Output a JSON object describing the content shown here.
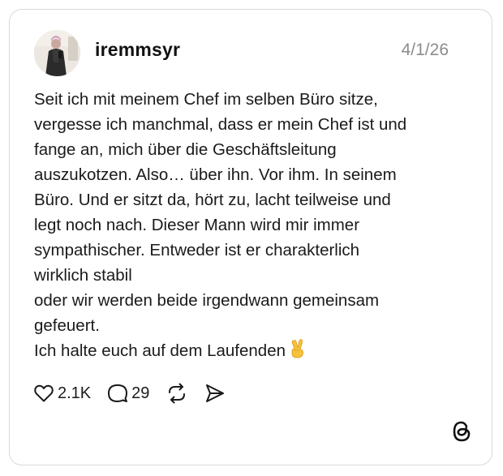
{
  "post": {
    "username": "iremmsyr",
    "date": "4/1/26",
    "text_lines": [
      "Seit ich mit meinem Chef im selben Büro sitze,",
      "vergesse ich manchmal, dass er mein Chef ist und",
      "fange an, mich über die Geschäftsleitung",
      "auszukotzen. Also… über ihn. Vor ihm. In seinem",
      "Büro. Und er sitzt da, hört zu, lacht teilweise und",
      "legt noch nach. Dieser Mann wird mir immer",
      "sympathischer. Entweder ist er charakterlich",
      "wirklich stabil",
      "oder wir werden beide irgendwann gemeinsam",
      "gefeuert.",
      "Ich halte euch auf dem Laufenden"
    ],
    "emoji": "✌️"
  },
  "actions": {
    "likes": "2.1K",
    "comments": "29"
  },
  "icons": {
    "like": "heart-icon",
    "comment": "speech-bubble-icon",
    "repost": "repost-icon",
    "share": "send-icon",
    "brand": "threads-logo-icon"
  },
  "colors": {
    "date_text": "#8c8c8c",
    "border": "#d9d9d9",
    "text": "#1a1a1a"
  }
}
